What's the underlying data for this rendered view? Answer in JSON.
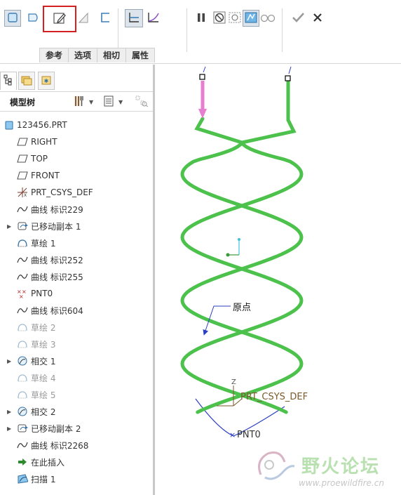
{
  "ribbon": {
    "tabs": [
      "参考",
      "选项",
      "相切",
      "属性"
    ],
    "tools_left": [
      "solid-icon",
      "surface-icon",
      "sketch-edit-icon",
      "remove-material-icon",
      "thin-icon",
      "constant-section-icon",
      "variable-section-icon"
    ],
    "tools_right": [
      "pause-icon",
      "no-preview-icon",
      "preview-icon",
      "verify-preview-icon",
      "glasses-icon",
      "ok-check-icon",
      "cancel-x-icon"
    ]
  },
  "panel": {
    "title": "模型树",
    "tree": [
      {
        "label": "123456.PRT",
        "icon": "part-icon",
        "expand": "",
        "dim": false
      },
      {
        "label": "RIGHT",
        "icon": "datum-plane-icon",
        "expand": "",
        "dim": false
      },
      {
        "label": "TOP",
        "icon": "datum-plane-icon",
        "expand": "",
        "dim": false
      },
      {
        "label": "FRONT",
        "icon": "datum-plane-icon",
        "expand": "",
        "dim": false
      },
      {
        "label": "PRT_CSYS_DEF",
        "icon": "csys-icon",
        "expand": "",
        "dim": false
      },
      {
        "label": "曲线 标识229",
        "icon": "curve-icon",
        "expand": "",
        "dim": false
      },
      {
        "label": "已移动副本 1",
        "icon": "moved-copy-icon",
        "expand": "▶",
        "dim": false
      },
      {
        "label": "草绘 1",
        "icon": "sketch-icon",
        "expand": "",
        "dim": false
      },
      {
        "label": "曲线 标识252",
        "icon": "curve-icon",
        "expand": "",
        "dim": false
      },
      {
        "label": "曲线 标识255",
        "icon": "curve-icon",
        "expand": "",
        "dim": false
      },
      {
        "label": "PNT0",
        "icon": "datum-point-icon",
        "expand": "",
        "dim": false
      },
      {
        "label": "曲线 标识604",
        "icon": "curve-icon",
        "expand": "",
        "dim": false
      },
      {
        "label": "草绘 2",
        "icon": "sketch-icon",
        "expand": "",
        "dim": true
      },
      {
        "label": "草绘 3",
        "icon": "sketch-icon",
        "expand": "",
        "dim": true
      },
      {
        "label": "相交 1",
        "icon": "intersect-icon",
        "expand": "▶",
        "dim": false
      },
      {
        "label": "草绘 4",
        "icon": "sketch-icon",
        "expand": "",
        "dim": true
      },
      {
        "label": "草绘 5",
        "icon": "sketch-icon",
        "expand": "",
        "dim": true
      },
      {
        "label": "相交 2",
        "icon": "intersect-icon",
        "expand": "▶",
        "dim": false
      },
      {
        "label": "已移动副本 2",
        "icon": "moved-copy-icon",
        "expand": "▶",
        "dim": false
      },
      {
        "label": "曲线 标识2268",
        "icon": "curve-icon",
        "expand": "",
        "dim": false
      },
      {
        "label": "在此插入",
        "icon": "insert-here-arrow-icon",
        "expand": "",
        "dim": false
      },
      {
        "label": "扫描 1",
        "icon": "sweep-icon",
        "expand": "",
        "dim": false
      }
    ]
  },
  "canvas": {
    "origin_label": "原点",
    "csys_label": "PRT_CSYS_DEF",
    "csys_axis_label": "Z",
    "point_label": "PNT0",
    "curve_color": "#4cc24c",
    "start_arrow_color": "#e77fd0"
  },
  "watermark": {
    "text": "野火论坛",
    "url": "www.proewildfire.cn"
  }
}
